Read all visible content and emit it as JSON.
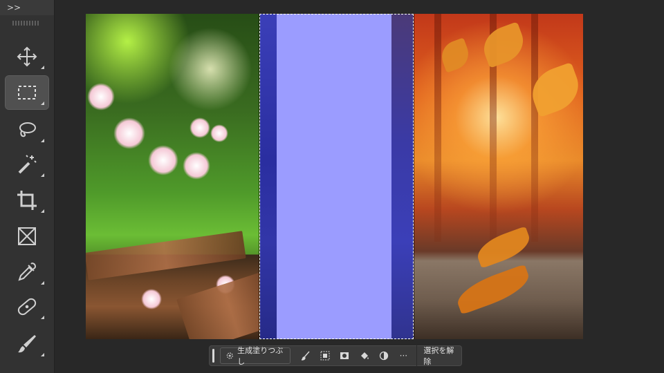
{
  "toolbar": {
    "expand_label": ">>",
    "tools": [
      {
        "name": "move-tool",
        "icon": "move-icon",
        "active": false
      },
      {
        "name": "rectangular-marquee-tool",
        "icon": "marquee-icon",
        "active": true
      },
      {
        "name": "lasso-tool",
        "icon": "lasso-icon",
        "active": false
      },
      {
        "name": "magic-wand-tool",
        "icon": "magic-wand-icon",
        "active": false
      },
      {
        "name": "crop-tool",
        "icon": "crop-icon",
        "active": false
      },
      {
        "name": "frame-tool",
        "icon": "frame-icon",
        "active": false
      },
      {
        "name": "eyedropper-tool",
        "icon": "eyedropper-icon",
        "active": false
      },
      {
        "name": "healing-brush-tool",
        "icon": "bandage-icon",
        "active": false
      },
      {
        "name": "brush-tool",
        "icon": "brush-icon",
        "active": false
      }
    ]
  },
  "canvas": {
    "selection_fill_color": "#9b9cff"
  },
  "context_bar": {
    "generative_fill_label": "生成塗りつぶし",
    "more_label": "···",
    "deselect_label": "選択を解除"
  },
  "colors": {
    "toolbar_bg": "#323232",
    "workspace_bg": "#282828",
    "active_tool_bg": "#505050"
  }
}
